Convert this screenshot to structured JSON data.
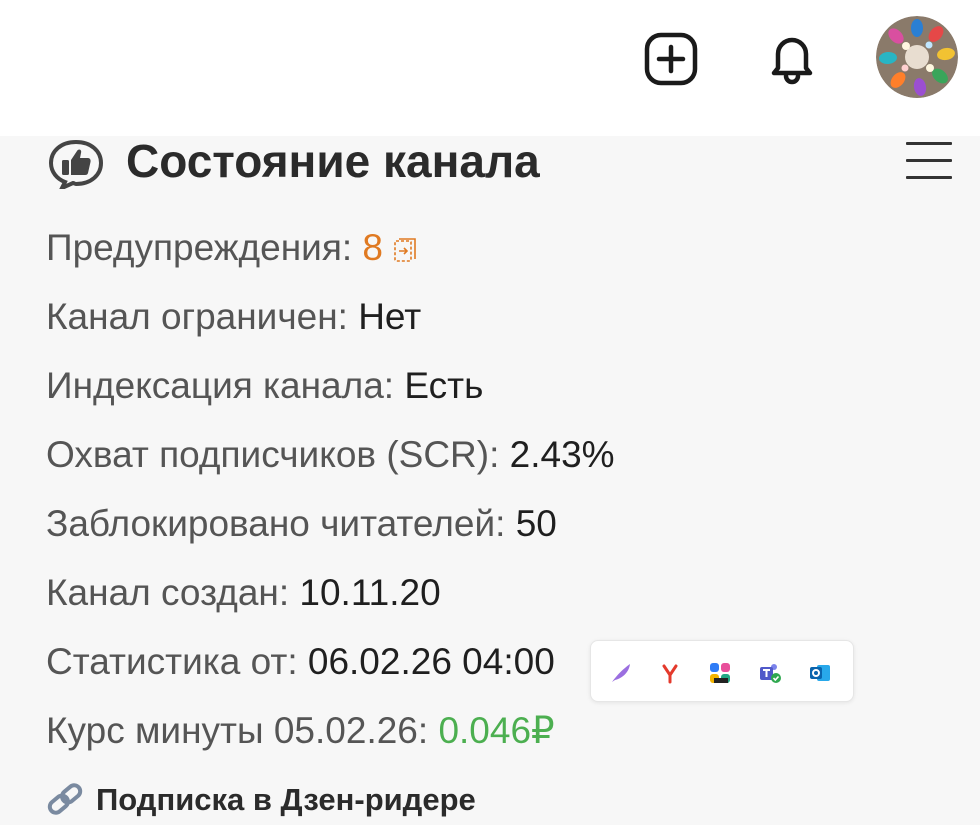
{
  "header": {
    "add_label": "+",
    "notifications_label": "notifications",
    "avatar_alt": "user avatar"
  },
  "channel_status": {
    "title": "Состояние канала",
    "rows": [
      {
        "label": "Предупреждения: ",
        "value": "8",
        "value_style": "warn",
        "has_copy_icon": true
      },
      {
        "label": "Канал ограничен: ",
        "value": "Нет"
      },
      {
        "label": "Индексация канала: ",
        "value": "Есть"
      },
      {
        "label": "Охват подписчиков (SCR): ",
        "value": "2.43%"
      },
      {
        "label": "Заблокировано читателей: ",
        "value": "50"
      },
      {
        "label": "Канал создан: ",
        "value": "10.11.20"
      },
      {
        "label": "Статистика от: ",
        "value": "06.02.26 04:00"
      },
      {
        "label": "Курс минуты 05.02.26: ",
        "value": "0.046₽",
        "value_style": "good"
      }
    ],
    "reader_link": "Подписка в Дзен-ридере"
  },
  "colors": {
    "warning": "#e07a22",
    "positive": "#4caf50",
    "panel_bg": "#f7f7f7"
  },
  "tray_icons": [
    "feather-icon",
    "yandex-icon",
    "copilot-icon",
    "teams-icon",
    "outlook-icon"
  ]
}
